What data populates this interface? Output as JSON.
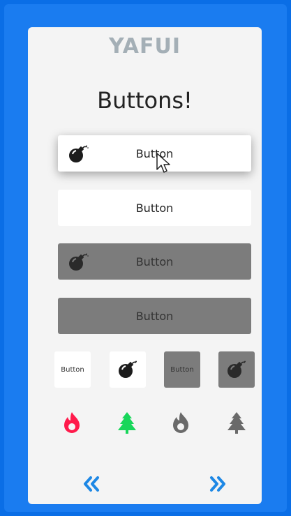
{
  "app": {
    "logo": "YAFUI",
    "title": "Buttons!"
  },
  "buttons_wide": [
    {
      "label": "Button",
      "icon": "bomb-icon",
      "style": "white-raised"
    },
    {
      "label": "Button",
      "icon": "",
      "style": "white"
    },
    {
      "label": "Button",
      "icon": "bomb-icon",
      "style": "grey"
    },
    {
      "label": "Button",
      "icon": "",
      "style": "grey"
    }
  ],
  "buttons_small": [
    {
      "label": "Button",
      "style": "white"
    },
    {
      "label": "",
      "icon": "bomb-icon",
      "style": "white"
    },
    {
      "label": "Button",
      "style": "grey"
    },
    {
      "label": "",
      "icon": "bomb-icon",
      "style": "grey"
    }
  ],
  "icon_buttons": [
    {
      "icon": "flame-icon",
      "color": "#ff1a4b"
    },
    {
      "icon": "tree-icon",
      "color": "#18d65a"
    },
    {
      "icon": "flame-icon",
      "color": "#6a6a6a"
    },
    {
      "icon": "tree-icon",
      "color": "#6a6a6a"
    }
  ],
  "nav": {
    "prev_icon": "double-chevron-left-icon",
    "next_icon": "double-chevron-right-icon",
    "color": "#1e88e5"
  },
  "colors": {
    "background": "#0a6ee6",
    "card": "#f4f4f4",
    "logo": "#a4afb6",
    "grey_button": "#7c7c7c"
  }
}
